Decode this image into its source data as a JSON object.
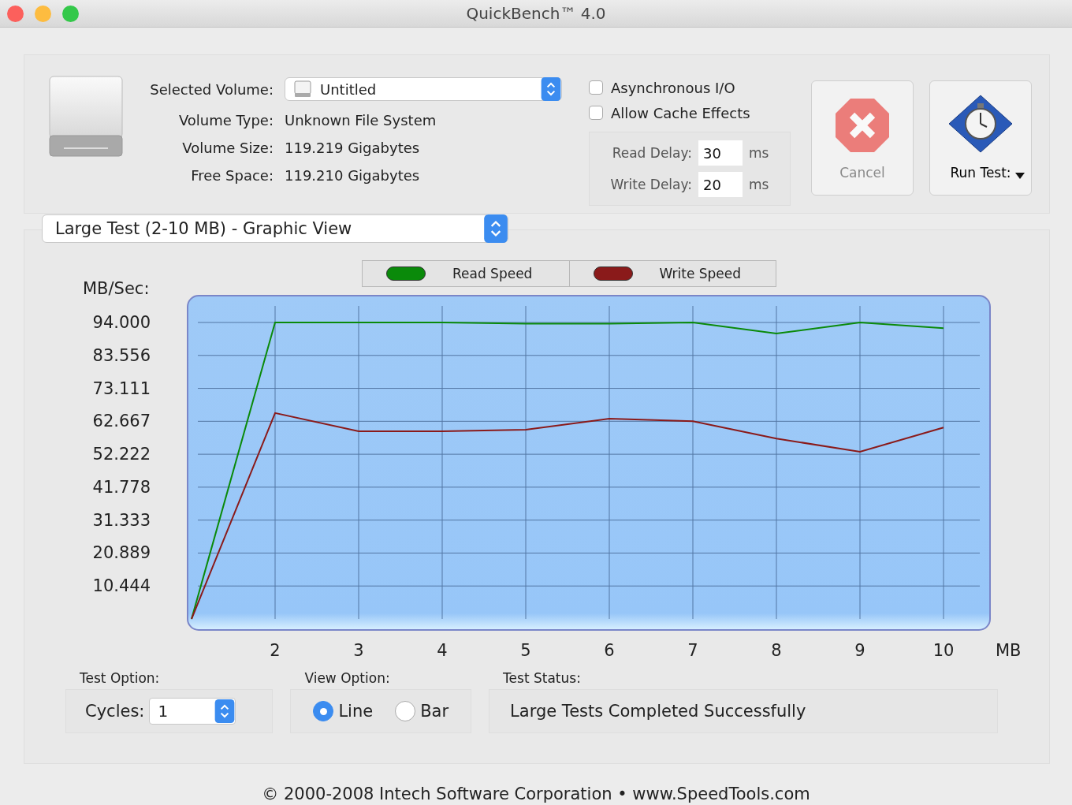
{
  "window": {
    "title": "QuickBench™ 4.0"
  },
  "volume": {
    "fields": [
      {
        "label": "Selected Volume:",
        "kind": "dropdown",
        "value": "Untitled"
      },
      {
        "label": "Volume Type:",
        "kind": "text",
        "value": "Unknown File System"
      },
      {
        "label": "Volume Size:",
        "kind": "text",
        "value": "119.219 Gigabytes"
      },
      {
        "label": "Free Space:",
        "kind": "text",
        "value": "119.210 Gigabytes"
      }
    ]
  },
  "options": [
    {
      "label": "Asynchronous I/O",
      "checked": false
    },
    {
      "label": "Allow Cache Effects",
      "checked": false
    }
  ],
  "delays": [
    {
      "label": "Read Delay:",
      "value": "30",
      "unit": "ms"
    },
    {
      "label": "Write Delay:",
      "value": "20",
      "unit": "ms"
    }
  ],
  "buttons": [
    {
      "label": "Cancel",
      "kind": "cancel",
      "disabled": true
    },
    {
      "label": "Run Test:",
      "kind": "run",
      "disabled": false
    }
  ],
  "view_selector": {
    "value": "Large Test (2-10 MB) - Graphic View"
  },
  "chart": {
    "chart_data": {
      "type": "line",
      "grid": true,
      "ylabel": "MB/Sec:",
      "xlabel": "MB",
      "x": [
        1,
        2,
        3,
        4,
        5,
        6,
        7,
        8,
        9,
        10
      ],
      "xlim": [
        1,
        10
      ],
      "ylim": [
        0,
        94
      ],
      "xticks": [
        2,
        3,
        4,
        5,
        6,
        7,
        8,
        9,
        10
      ],
      "yticks": [
        {
          "value": 10.444,
          "label": "10.444"
        },
        {
          "value": 20.889,
          "label": "20.889"
        },
        {
          "value": 31.333,
          "label": "31.333"
        },
        {
          "value": 41.778,
          "label": "41.778"
        },
        {
          "value": 52.222,
          "label": "52.222"
        },
        {
          "value": 62.667,
          "label": "62.667"
        },
        {
          "value": 73.111,
          "label": "73.111"
        },
        {
          "value": 83.556,
          "label": "83.556"
        },
        {
          "value": 94,
          "label": "94.000"
        }
      ],
      "series": [
        {
          "name": "Read Speed",
          "color": "#0a8a0a",
          "values": [
            0,
            94,
            94,
            94,
            93.6,
            93.6,
            94,
            90.5,
            94,
            92.2
          ]
        },
        {
          "name": "Write Speed",
          "color": "#8a1a1a",
          "values": [
            0,
            65.3,
            59.5,
            59.5,
            60,
            63.5,
            62.7,
            57.2,
            53,
            60.7
          ]
        }
      ]
    }
  },
  "test_option": {
    "label": "Test Option:",
    "field_label": "Cycles:",
    "value": "1"
  },
  "view_option": {
    "label": "View Option:",
    "choices": [
      {
        "label": "Line",
        "selected": true
      },
      {
        "label": "Bar",
        "selected": false
      }
    ]
  },
  "test_status": {
    "label": "Test Status:",
    "value": "Large Tests Completed Successfully"
  },
  "footer": "© 2000-2008 Intech Software Corporation • www.SpeedTools.com"
}
